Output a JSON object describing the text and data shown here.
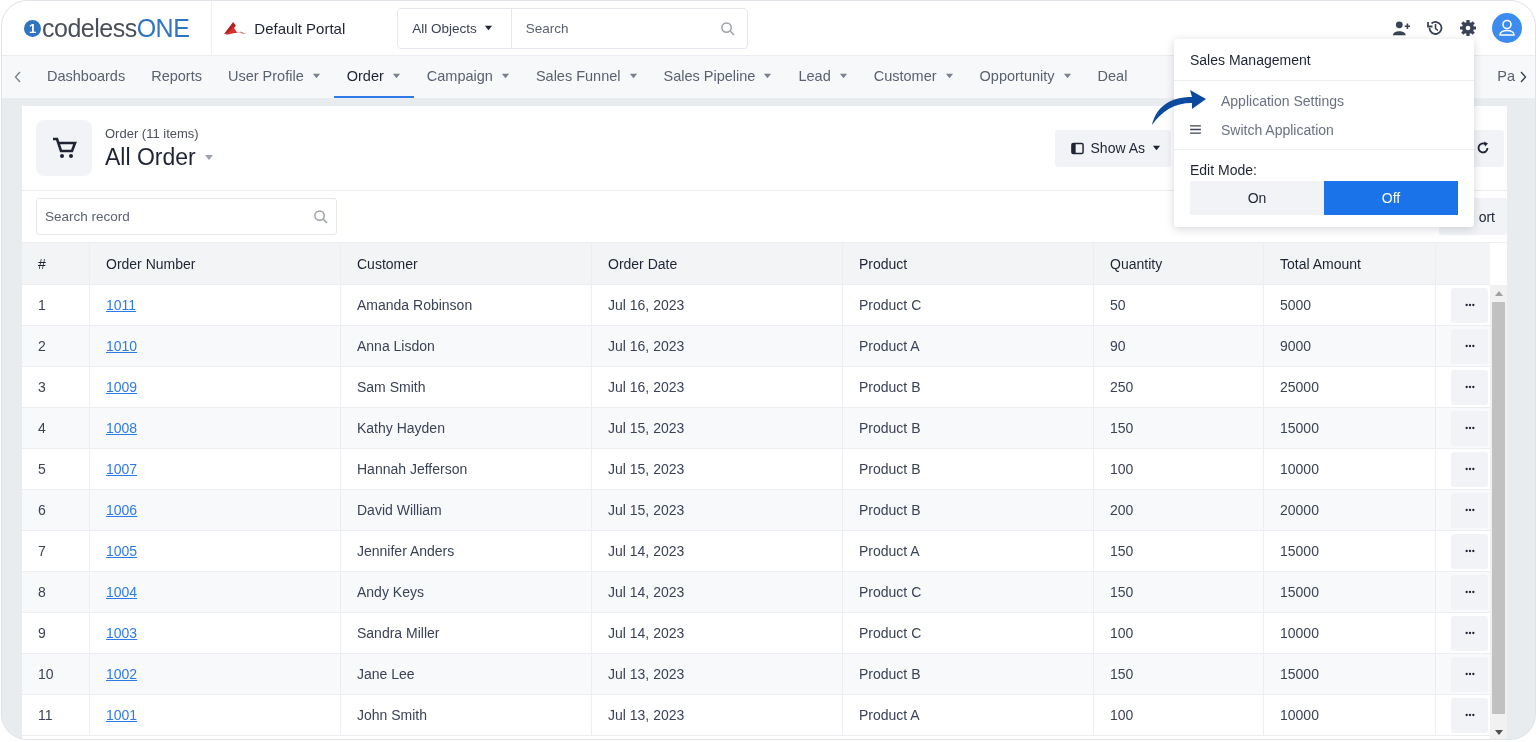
{
  "header": {
    "logo_prefix": "1",
    "logo_text": "codeless",
    "logo_suffix": "ONE",
    "portal": "Default Portal",
    "object_scope": "All Objects",
    "search_placeholder": "Search"
  },
  "nav": {
    "items": [
      {
        "label": "Dashboards",
        "has_menu": false,
        "selected": false
      },
      {
        "label": "Reports",
        "has_menu": false,
        "selected": false
      },
      {
        "label": "User Profile",
        "has_menu": true,
        "selected": false
      },
      {
        "label": "Order",
        "has_menu": true,
        "selected": true
      },
      {
        "label": "Campaign",
        "has_menu": true,
        "selected": false
      },
      {
        "label": "Sales Funnel",
        "has_menu": true,
        "selected": false
      },
      {
        "label": "Sales Pipeline",
        "has_menu": true,
        "selected": false
      },
      {
        "label": "Lead",
        "has_menu": true,
        "selected": false
      },
      {
        "label": "Customer",
        "has_menu": true,
        "selected": false
      },
      {
        "label": "Opportunity",
        "has_menu": true,
        "selected": false
      },
      {
        "label": "Deal",
        "has_menu": false,
        "selected": false
      }
    ],
    "last_item": "Pa"
  },
  "view": {
    "subtitle": "Order (11 items)",
    "title": "All Order",
    "show_as": "Show As",
    "export_partial": "ort",
    "search_placeholder": "Search record"
  },
  "table": {
    "columns": [
      "#",
      "Order Number",
      "Customer",
      "Order Date",
      "Product",
      "Quantity",
      "Total Amount"
    ],
    "rows": [
      [
        "1",
        "1011",
        "Amanda Robinson",
        "Jul 16, 2023",
        "Product C",
        "50",
        "5000"
      ],
      [
        "2",
        "1010",
        "Anna Lisdon",
        "Jul 16, 2023",
        "Product A",
        "90",
        "9000"
      ],
      [
        "3",
        "1009",
        "Sam Smith",
        "Jul 16, 2023",
        "Product B",
        "250",
        "25000"
      ],
      [
        "4",
        "1008",
        "Kathy Hayden",
        "Jul 15, 2023",
        "Product B",
        "150",
        "15000"
      ],
      [
        "5",
        "1007",
        "Hannah Jefferson",
        "Jul 15, 2023",
        "Product B",
        "100",
        "10000"
      ],
      [
        "6",
        "1006",
        "David William",
        "Jul 15, 2023",
        "Product B",
        "200",
        "20000"
      ],
      [
        "7",
        "1005",
        "Jennifer Anders",
        "Jul 14, 2023",
        "Product A",
        "150",
        "15000"
      ],
      [
        "8",
        "1004",
        "Andy Keys",
        "Jul 14, 2023",
        "Product C",
        "150",
        "15000"
      ],
      [
        "9",
        "1003",
        "Sandra Miller",
        "Jul 14, 2023",
        "Product C",
        "100",
        "10000"
      ],
      [
        "10",
        "1002",
        "Jane Lee",
        "Jul 13, 2023",
        "Product B",
        "150",
        "15000"
      ],
      [
        "11",
        "1001",
        "John Smith",
        "Jul 13, 2023",
        "Product A",
        "100",
        "10000"
      ]
    ]
  },
  "menu": {
    "title": "Sales Management",
    "items": [
      {
        "label": "Application Settings",
        "kind": "plain"
      },
      {
        "label": "Switch Application",
        "kind": "switch"
      }
    ],
    "edit_mode_label": "Edit Mode:",
    "edit_mode_options": [
      {
        "label": "On",
        "selected": false
      },
      {
        "label": "Off",
        "selected": true
      }
    ]
  }
}
